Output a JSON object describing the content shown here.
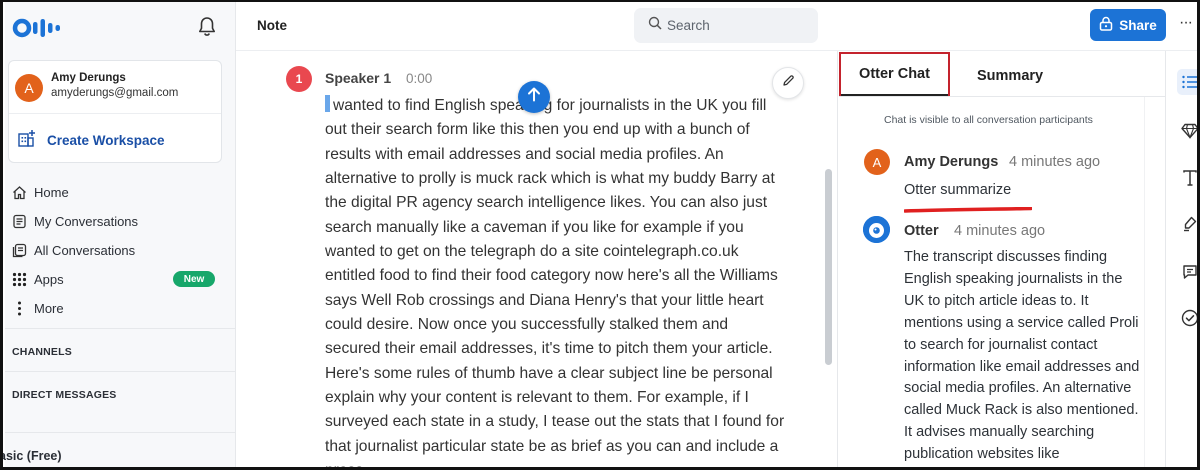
{
  "app": {
    "logo_text": "Oll•",
    "note_label": "Note",
    "search_placeholder": "Search",
    "share_label": "Share",
    "more_label": "···"
  },
  "account": {
    "initial": "A",
    "name": "Amy Derungs",
    "email": "amyderungs@gmail.com",
    "create_workspace": "Create Workspace"
  },
  "nav": {
    "home": "Home",
    "my_conversations": "My Conversations",
    "all_conversations": "All Conversations",
    "apps": "Apps",
    "apps_badge": "New",
    "more": "More"
  },
  "sections": {
    "channels": "CHANNELS",
    "direct_messages": "DIRECT MESSAGES",
    "plan": "asic (Free)"
  },
  "transcript": {
    "speaker_number": "1",
    "speaker_name": "Speaker 1",
    "timestamp": "0:00",
    "text": "wanted to find English speaking for journalists in the UK you fill out their search form like this then you end up with a bunch of results with email addresses and social media profiles. An alternative to prolly is muck rack which is what my buddy Barry at the digital PR agency search intelligence likes. You can also just search manually like a caveman if you like for example if you wanted to get on the telegraph do a site cointelegraph.co.uk entitled food to find their food category now here's all the Williams says Well Rob crossings and Diana Henry's that your little heart could desire. Now once you successfully stalked them and secured their email addresses, it's time to pitch them your article. Here's some rules of thumb have a clear subject line be personal explain why your content is relevant to them. For example, if I surveyed each state in a study, I tease out the stats that I found for that journalist particular state be as brief as you can and include a press"
  },
  "chat": {
    "tab_otter_chat": "Otter Chat",
    "tab_summary": "Summary",
    "visibility_note": "Chat is visible to all conversation participants",
    "messages": [
      {
        "author": "Amy Derungs",
        "avatar_initial": "A",
        "time": "4 minutes ago",
        "body": "Otter summarize"
      },
      {
        "author": "Otter",
        "time": "4 minutes ago",
        "body": "The transcript discusses finding English speaking journalists in the UK to pitch article ideas to. It mentions using a service called Proli to search for journalist contact information like email addresses and social media profiles. An alternative called Muck Rack is also mentioned. It advises manually searching publication websites like"
      }
    ]
  },
  "colors": {
    "accent_blue": "#1c73d6",
    "avatar_orange": "#e2621b",
    "speaker_red": "#e9484f",
    "badge_green": "#17a76a",
    "highlight_red": "#c4232d"
  }
}
